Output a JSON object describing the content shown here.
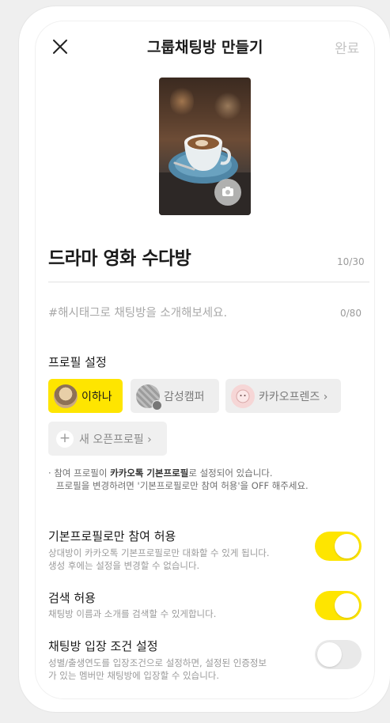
{
  "header": {
    "title": "그룹채팅방 만들기",
    "done_label": "완료"
  },
  "room": {
    "name": "드라마 영화 수다방",
    "name_count": "10/30",
    "hashtag_placeholder": "#해시태그로 채팅방을 소개해보세요.",
    "hashtag_count": "0/80"
  },
  "profile": {
    "section_label": "프로필 설정",
    "chips": [
      {
        "label": "이하나",
        "selected": true
      },
      {
        "label": "감성캠퍼",
        "selected": false
      },
      {
        "label": "카카오프렌즈 ›",
        "selected": false
      }
    ],
    "new_profile_label": "새 오픈프로필 ›",
    "note_prefix": "참여 프로필이 ",
    "note_bold": "카카오톡 기본프로필",
    "note_suffix": "로 설정되어 있습니다.",
    "note_line2": "프로필을 변경하려면 '기본프로필로만 참여 허용'을 OFF 해주세요."
  },
  "options": [
    {
      "title": "기본프로필로만 참여 허용",
      "desc1": "상대방이 카카오톡 기본프로필로만 대화할 수 있게 됩니다.",
      "desc2": "생성 후에는 설정을 변경할 수 없습니다.",
      "on": true
    },
    {
      "title": "검색 허용",
      "desc1": "채팅방 이름과 소개를 검색할 수 있게합니다.",
      "desc2": "",
      "on": true
    },
    {
      "title": "채팅방 입장 조건 설정",
      "desc1": "성별/출생연도를 입장조건으로 설정하면, 설정된 인증정보",
      "desc2": "가 있는 멤버만 채팅방에 입장할 수 있습니다.",
      "on": false
    }
  ],
  "colors": {
    "accent": "#fee500",
    "toggle_off": "#e9e9e9"
  }
}
